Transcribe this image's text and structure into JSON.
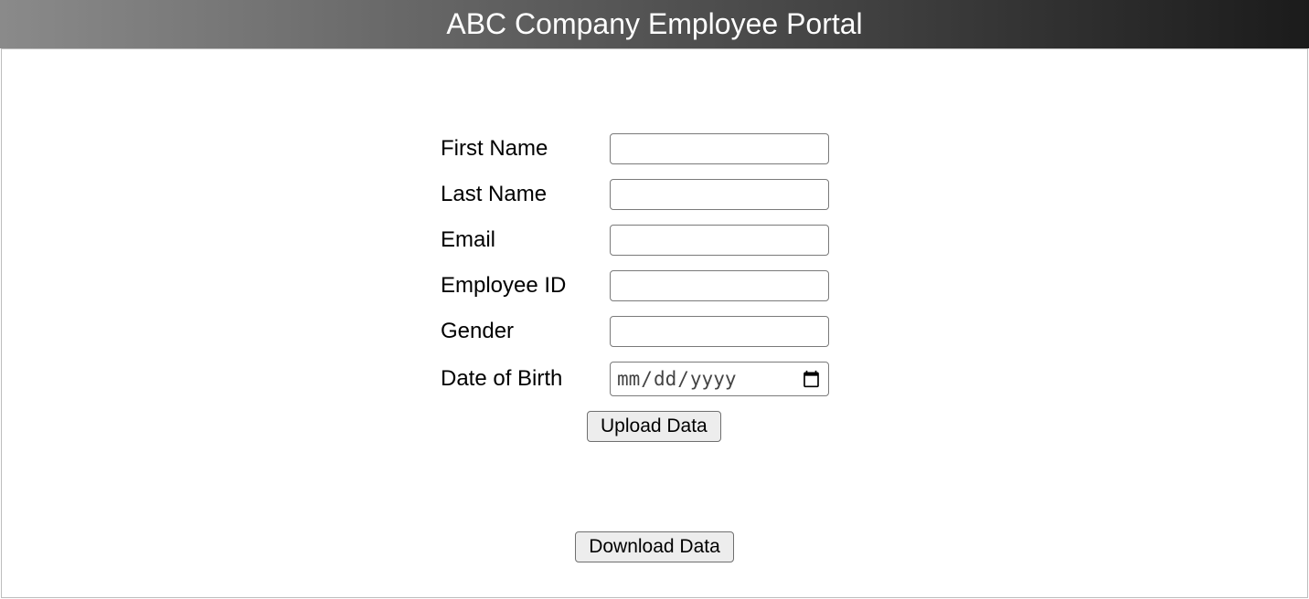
{
  "header": {
    "title": "ABC Company Employee Portal"
  },
  "form": {
    "first_name": {
      "label": "First Name",
      "value": ""
    },
    "last_name": {
      "label": "Last Name",
      "value": ""
    },
    "email": {
      "label": "Email",
      "value": ""
    },
    "employee_id": {
      "label": "Employee ID",
      "value": ""
    },
    "gender": {
      "label": "Gender",
      "value": ""
    },
    "dob": {
      "label": "Date of Birth",
      "value": "",
      "placeholder": "mm/dd/yyyy"
    }
  },
  "buttons": {
    "upload": "Upload Data",
    "download": "Download Data"
  }
}
